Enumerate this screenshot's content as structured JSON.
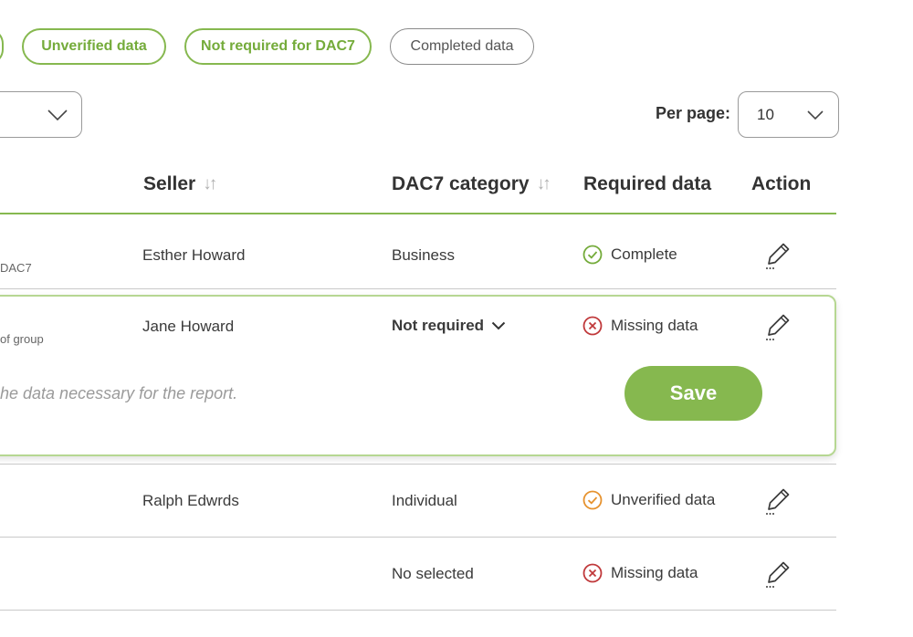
{
  "filters": {
    "unverified_label": "Unverified data",
    "not_required_label": "Not required for DAC7",
    "completed_label": "Completed data"
  },
  "pagination": {
    "per_page_label": "Per page:",
    "per_page_value": "10"
  },
  "table": {
    "headers": {
      "seller": "Seller",
      "category": "DAC7 category",
      "required": "Required data",
      "action": "Action"
    },
    "rows": [
      {
        "subtext": "DAC7",
        "seller": "Esther Howard",
        "category": "Business",
        "status": "Complete",
        "status_kind": "complete"
      },
      {
        "subtext": "of group",
        "seller": "Jane Howard",
        "category": "Not required",
        "status": "Missing data",
        "status_kind": "missing",
        "note": "he data necessary for the report.",
        "save_label": "Save"
      },
      {
        "seller": "Ralph Edwrds",
        "category": "Individual",
        "status": "Unverified data",
        "status_kind": "unverified"
      },
      {
        "seller": "",
        "category": "No selected",
        "status": "Missing data",
        "status_kind": "missing"
      }
    ]
  },
  "icons": {
    "sort": "sort-icon",
    "chevron": "chevron-down-icon",
    "complete": "check-circle-icon",
    "missing": "x-circle-icon",
    "unverified": "check-circle-icon",
    "edit": "pencil-icon"
  },
  "colors": {
    "accent": "#86b84f",
    "complete": "#74ab3a",
    "missing": "#c0393b",
    "unverified": "#e6922e"
  }
}
